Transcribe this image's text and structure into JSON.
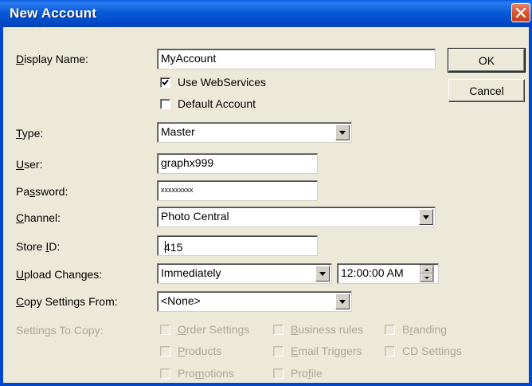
{
  "window": {
    "title": "New Account"
  },
  "labels": {
    "display_name_pre": "",
    "display_name_ul": "D",
    "display_name_post": "isplay Name:",
    "type_pre": "",
    "type_ul": "T",
    "type_post": "ype:",
    "user_pre": "",
    "user_ul": "U",
    "user_post": "ser:",
    "password_pre": "Pa",
    "password_ul": "s",
    "password_post": "sword:",
    "channel_pre": "",
    "channel_ul": "C",
    "channel_post": "hannel:",
    "store_pre": "Store ",
    "store_ul": "I",
    "store_post": "D:",
    "upload_pre": "",
    "upload_ul": "U",
    "upload_post": "pload Changes:",
    "copy_pre": "",
    "copy_ul": "C",
    "copy_post": "opy Settings From:",
    "settings_to_copy": "Settings To Copy:"
  },
  "fields": {
    "display_name": "MyAccount",
    "type": "Master",
    "user": "graphx999",
    "password": "xxxxxxxxx",
    "channel": "Photo Central",
    "store_id": "415",
    "upload_changes": "Immediately",
    "upload_time": "12:00:00 AM",
    "copy_settings_from": "<None>"
  },
  "checkboxes": {
    "use_webservices": {
      "label": "Use WebServices",
      "checked": true
    },
    "default_account": {
      "label": "Default Account",
      "checked": false
    }
  },
  "copy_options": {
    "order_settings": {
      "pre": "",
      "ul": "O",
      "post": "rder Settings"
    },
    "business_rules": {
      "pre": "",
      "ul": "B",
      "post": "usiness rules"
    },
    "branding": {
      "pre": "B",
      "ul": "r",
      "post": "anding"
    },
    "products": {
      "pre": "",
      "ul": "P",
      "post": "roducts"
    },
    "email_triggers": {
      "pre": "",
      "ul": "E",
      "post": "mail Triggers"
    },
    "cd_settings": {
      "pre": "CD Settings",
      "ul": "",
      "post": ""
    },
    "promotions": {
      "pre": "Pro",
      "ul": "m",
      "post": "otions"
    },
    "profile": {
      "pre": "Pro",
      "ul": "f",
      "post": "ile"
    }
  },
  "buttons": {
    "ok": "OK",
    "cancel": "Cancel"
  },
  "colors": {
    "title_bar": "#0A5ADC",
    "dialog_bg": "#ECE9D8",
    "close_button": "#D9542F",
    "disabled_text": "#ACA899"
  },
  "icons": {
    "close": "close-icon",
    "checkmark": "checkmark-icon",
    "dropdown": "chevron-down-icon",
    "spin": "spin-arrows-icon"
  }
}
